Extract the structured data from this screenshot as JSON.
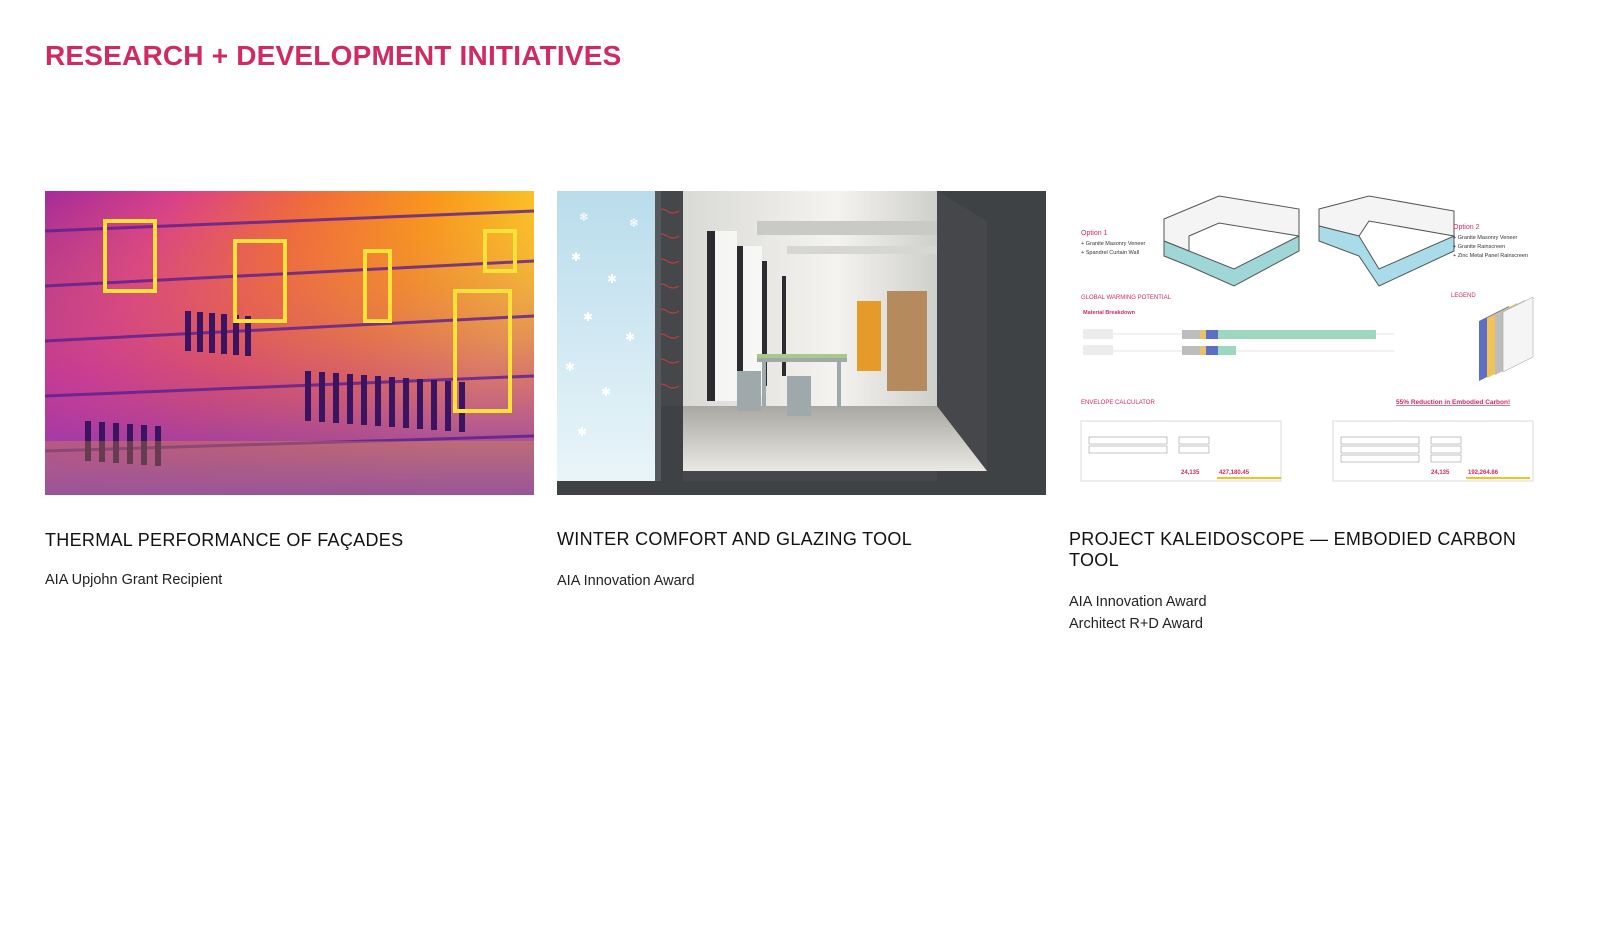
{
  "page": {
    "title": "RESEARCH + DEVELOPMENT INITIATIVES",
    "accent_color": "#d02a62"
  },
  "cards": [
    {
      "title": "THERMAL PERFORMANCE OF FAÇADES",
      "awards": [
        "AIA Upjohn Grant Recipient"
      ],
      "image": "thermal-facade-image"
    },
    {
      "title": "WINTER COMFORT AND GLAZING TOOL",
      "awards": [
        "AIA Innovation Award"
      ],
      "image": "winter-comfort-section-image"
    },
    {
      "title": "PROJECT KALEIDOSCOPE — EMBODIED CARBON TOOL",
      "awards": [
        "AIA Innovation Award",
        "Architect R+D Award"
      ],
      "image": "embodied-carbon-tool-image",
      "figure": {
        "option1_heading": "Option 1",
        "option1_items": [
          "+ Granite Masonry Veneer",
          "+ Spandrel Curtain Wall"
        ],
        "option2_heading": "Option 2",
        "option2_items": [
          "+ Granite Masonry Veneer",
          "+ Granite Rainscreen",
          "+ Zinc Metal Panel Rainscreen"
        ],
        "gwp_heading": "GLOBAL WARMING POTENTIAL",
        "material_breakdown": "Material Breakdown",
        "legend_heading": "LEGEND",
        "envelope_heading": "ENVELOPE CALCULATOR",
        "reduction_note": "55% Reduction in Embodied Carbon!",
        "option1_total_sf": "24,135",
        "option1_total_gwp": "427,180.45",
        "option2_total_sf": "24,135",
        "option2_total_gwp": "192,264.86"
      }
    }
  ]
}
